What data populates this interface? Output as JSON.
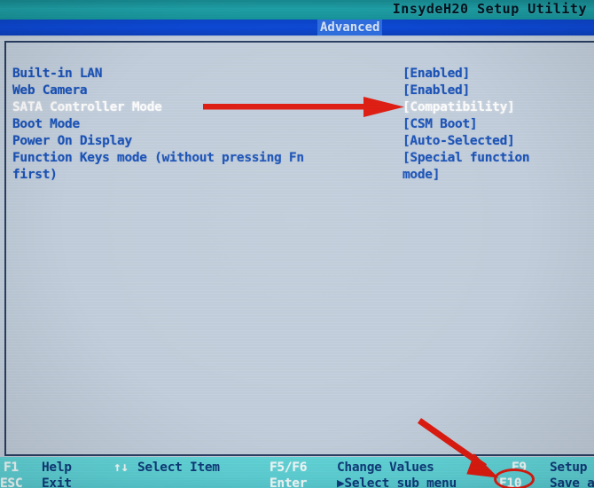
{
  "header": {
    "title": "InsydeH20 Setup Utility",
    "active_tab": "Advanced",
    "tabs": [
      "Advanced"
    ]
  },
  "main": {
    "options": [
      {
        "label": "Built-in LAN",
        "value": "[Enabled]",
        "selected": false
      },
      {
        "label": "Web Camera",
        "value": "[Enabled]",
        "selected": false
      },
      {
        "label": "SATA Controller Mode",
        "value": "[Compatibility]",
        "selected": true
      },
      {
        "label": "Boot Mode",
        "value": "[CSM Boot]",
        "selected": false
      },
      {
        "label": "Power On Display",
        "value": "[Auto-Selected]",
        "selected": false
      },
      {
        "label": "Function Keys mode (without pressing Fn",
        "label_line2": "first)",
        "value": "[Special function",
        "value_line2": "mode]",
        "selected": false
      }
    ]
  },
  "footer": {
    "items": [
      {
        "key": "F1",
        "label": "Help"
      },
      {
        "key": "ESC",
        "label": "Exit"
      },
      {
        "key": "↑↓",
        "label": "Select Item"
      },
      {
        "key": "F5/F6",
        "label": "Change Values"
      },
      {
        "key": "Enter",
        "label": "▶Select sub menu"
      },
      {
        "key": "F9",
        "label": "Setup"
      },
      {
        "key": "F10",
        "label": "Save a"
      }
    ]
  },
  "annotations": {
    "arrow_color": "#e01b10",
    "circle_color": "#e01b10",
    "arrow_sata_target": "[Compatibility]",
    "arrow_f10_target": "F10"
  },
  "colors": {
    "header_teal": "#1ea0a6",
    "header_blue": "#0d49d6",
    "tab_highlight": "#2f6ee0",
    "panel_bg": "#c3cfdd",
    "text_blue": "#1b53b8",
    "text_selected": "#fdfdfd",
    "footer_teal": "#5fd2d7",
    "footer_key": "#f4fbfb",
    "footer_label": "#0f3b7a",
    "accent_red": "#e01b10"
  }
}
